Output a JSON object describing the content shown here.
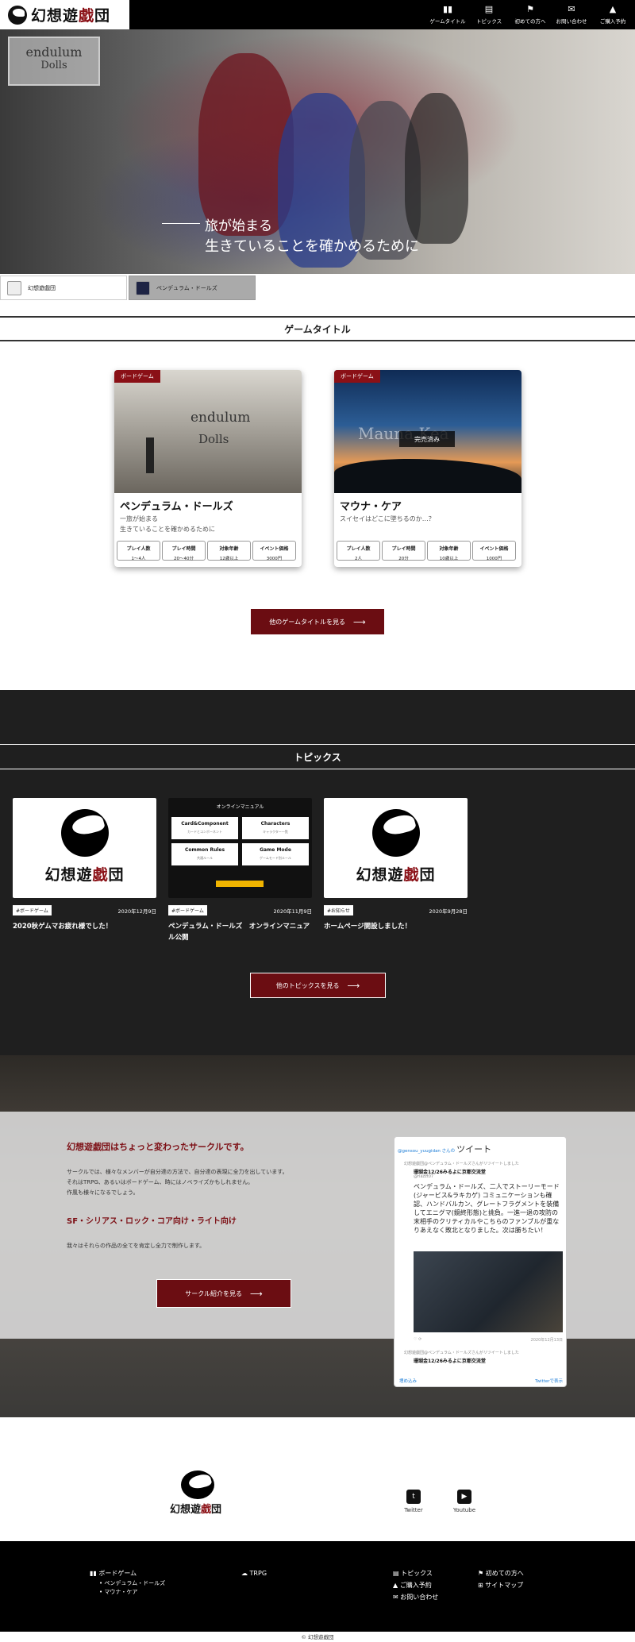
{
  "header": {
    "logo_main": "幻想遊",
    "logo_accent": "戯",
    "logo_end": "団",
    "nav": [
      {
        "icon": "▮▮",
        "label": "ゲームタイトル"
      },
      {
        "icon": "▤",
        "label": "トピックス"
      },
      {
        "icon": "⚑",
        "label": "初めての方へ"
      },
      {
        "icon": "✉",
        "label": "お問い合わせ"
      },
      {
        "icon": "▲",
        "label": "ご購入予約"
      }
    ]
  },
  "hero": {
    "logo_top": "endulum",
    "logo_bottom": "Dolls",
    "caption1": "旅が始まる",
    "caption2": "生きていることを確かめるために"
  },
  "tabs": [
    {
      "label": "幻想遊戯団"
    },
    {
      "label": "ペンデュラム・ドールズ"
    }
  ],
  "games": {
    "title": "ゲームタイトル",
    "cards": [
      {
        "badge": "ボードゲーム",
        "name": "ペンデュラム・ドールズ",
        "desc1": "一旅が始まる",
        "desc2": "生きていることを確かめるために",
        "img_text_top": "endulum",
        "img_text_bottom": "Dolls",
        "specs": [
          {
            "k": "プレイ人数",
            "v": "1〜4人"
          },
          {
            "k": "プレイ時間",
            "v": "20〜40分"
          },
          {
            "k": "対象年齢",
            "v": "12歳以上"
          },
          {
            "k": "イベント価格",
            "v": "3000円"
          }
        ]
      },
      {
        "badge": "ボードゲーム",
        "name": "マウナ・ケア",
        "desc1": "スイセイはどこに墜ちるのか…？",
        "desc2": "",
        "img_text_top": "Mauna Kea",
        "img_text_bottom": "",
        "sold": "完売済み",
        "specs": [
          {
            "k": "プレイ人数",
            "v": "2人"
          },
          {
            "k": "プレイ時間",
            "v": "20分"
          },
          {
            "k": "対象年齢",
            "v": "10歳以上"
          },
          {
            "k": "イベント価格",
            "v": "1000円"
          }
        ]
      }
    ],
    "more": "他のゲームタイトルを見る"
  },
  "topics": {
    "title": "トピックス",
    "items": [
      {
        "tag": "#ボードゲーム",
        "date": "2020年12月9日",
        "title": "2020秋ゲムマお疲れ様でした！"
      },
      {
        "tag": "#ボードゲーム",
        "date": "2020年11月9日",
        "title": "ペンデュラム・ドールズ　オンラインマニュアル公開",
        "manual": {
          "head": "オンラインマニュアル",
          "cells": [
            {
              "t": "Card&Component",
              "s": "カードとコンポーネント"
            },
            {
              "t": "Characters",
              "s": "キャラクター一覧"
            },
            {
              "t": "Common Rules",
              "s": "共通ルール"
            },
            {
              "t": "Game Mode",
              "s": "ゲームモード別ルール"
            }
          ]
        }
      },
      {
        "tag": "#お知らせ",
        "date": "2020年9月28日",
        "title": "ホームページ開設しました！"
      }
    ],
    "more": "他のトピックスを見る"
  },
  "about": {
    "heading": "幻想遊戯団はちょっと変わったサークルです。",
    "p1": "サークルでは、様々なメンバーが自分達の方法で、自分達の表現に全力を出しています。",
    "p2": "それはTRPG、あるいはボードゲーム、時にはノベライズかもしれません。",
    "p3": "作風も様々になるでしょう。",
    "heading2": "SF・シリアス・ロック・コア向け・ライト向け",
    "p4": "我々はそれらの作品の全てを肯定し全力で制作します。",
    "more": "サークル紹介を見る"
  },
  "tweet": {
    "by": "@gensou_yuugidan さんの",
    "title": "ツイート",
    "rt": "幻想遊戯団@ペンデュラム・ドールズさんがリツイートしました",
    "name": "珊瑚金12/26みるよに京都交流堂",
    "handle": "@rlazzt07",
    "body": "ペンデュラム・ドールズ、二人でストーリーモード(ジャービス&ラキカゲ)\nコミュニケーションも確認、ハンドバルカン、グレートフラグメントを装備してエニグマ(鏡終形態)と挑負。一進一退の攻防の末相手のクリティカルやこちらのファンブルが重なりあえなく敗北となりました。次は勝ちたい！",
    "date": "2020年12月13日",
    "rt2": "幻想遊戯団@ペンデュラム・ドールズさんがリツイートしました",
    "name2": "珊瑚金12/26みるよに京都交流堂",
    "embed": "埋め込み",
    "view": "Twitterで表示"
  },
  "social": [
    {
      "icon": "t",
      "label": "Twitter"
    },
    {
      "icon": "▶",
      "label": "Youtube"
    }
  ],
  "footer": {
    "col1_title": "ボードゲーム",
    "col1_items": [
      "ペンデュラム・ドールズ",
      "マウナ・ケア"
    ],
    "col2_title": "TRPG",
    "col3": [
      "トピックス",
      "ご購入予約",
      "お問い合わせ"
    ],
    "col4": [
      "初めての方へ",
      "サイトマップ"
    ],
    "copy": "© 幻想遊戯団"
  }
}
